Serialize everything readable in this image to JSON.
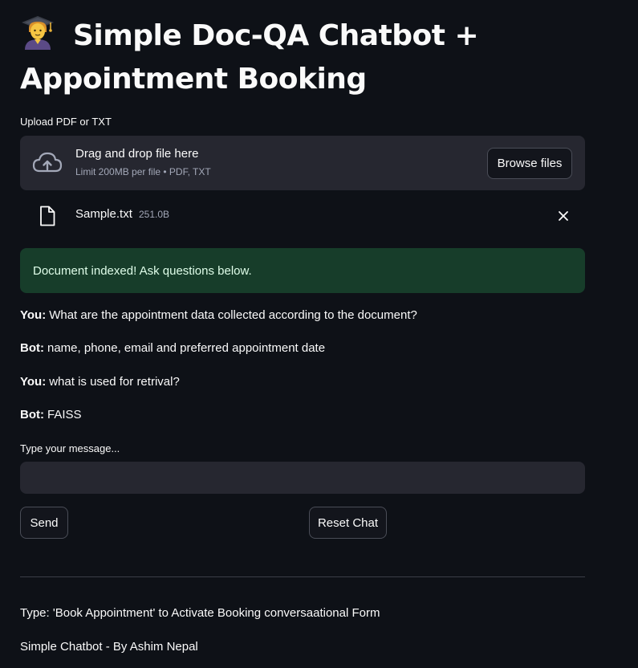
{
  "header": {
    "emoji": "🧑‍🎓",
    "title": "Simple Doc-QA Chatbot + Appointment Booking"
  },
  "uploader": {
    "label": "Upload PDF or TXT",
    "drag_text": "Drag and drop file here",
    "limit_text": "Limit 200MB per file • PDF, TXT",
    "browse_label": "Browse files",
    "icon": "cloud-upload-icon"
  },
  "file": {
    "name": "Sample.txt",
    "size": "251.0B",
    "icon": "file-icon"
  },
  "alert": {
    "text": "Document indexed! Ask questions below.",
    "background": "#173d2a",
    "color": "#dffde9"
  },
  "chat": [
    {
      "speaker": "You:",
      "text": "What are the appointment data collected according to the document?"
    },
    {
      "speaker": "Bot:",
      "text": "name, phone, email and preferred appointment date"
    },
    {
      "speaker": "You:",
      "text": "what is used for retrival?"
    },
    {
      "speaker": "Bot:",
      "text": "FAISS"
    }
  ],
  "input": {
    "label": "Type your message...",
    "value": "",
    "placeholder": ""
  },
  "buttons": {
    "send": "Send",
    "reset": "Reset Chat"
  },
  "footer": {
    "instruction": "Type: 'Book Appointment' to Activate Booking conversaational Form",
    "credit": "Simple Chatbot - By Ashim Nepal"
  },
  "colors": {
    "background": "#0e1117",
    "surface": "#262730",
    "text": "#fafafa",
    "muted": "#a3a8b8"
  }
}
